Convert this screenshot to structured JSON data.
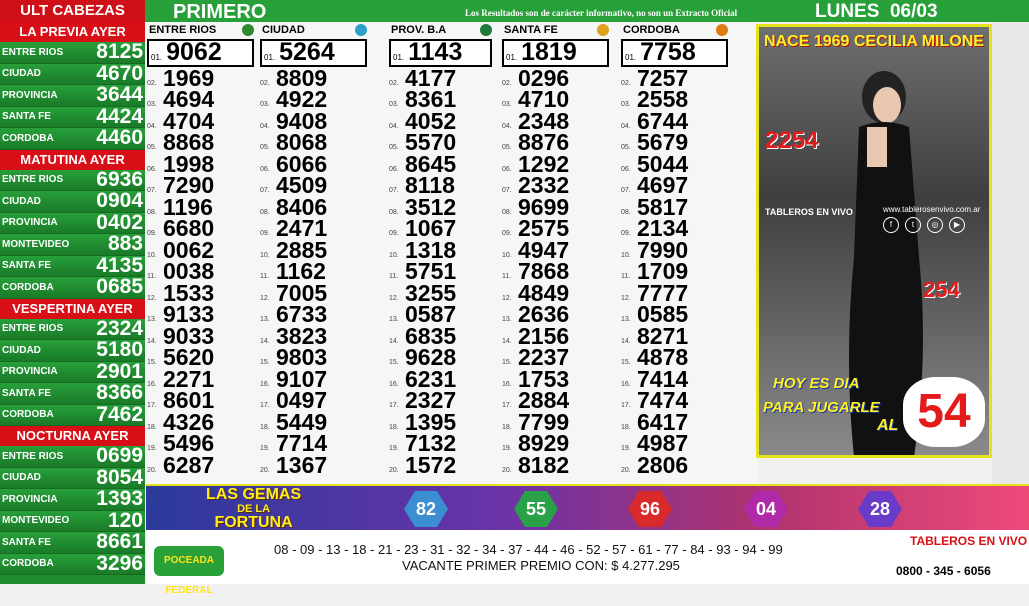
{
  "sidebar": {
    "title": "ULT CABEZAS",
    "sections": [
      {
        "heading": "LA PREVIA AYER",
        "rows": [
          {
            "name": "ENTRE RIOS",
            "value": "8125"
          },
          {
            "name": "CIUDAD",
            "value": "4670"
          },
          {
            "name": "PROVINCIA",
            "value": "3644"
          },
          {
            "name": "SANTA FE",
            "value": "4424"
          },
          {
            "name": "CORDOBA",
            "value": "4460"
          }
        ]
      },
      {
        "heading": "MATUTINA AYER",
        "rows": [
          {
            "name": "ENTRE RIOS",
            "value": "6936"
          },
          {
            "name": "CIUDAD",
            "value": "0904"
          },
          {
            "name": "PROVINCIA",
            "value": "0402"
          },
          {
            "name": "MONTEVIDEO",
            "value": "883"
          },
          {
            "name": "SANTA FE",
            "value": "4135"
          },
          {
            "name": "CORDOBA",
            "value": "0685"
          }
        ]
      },
      {
        "heading": "VESPERTINA AYER",
        "rows": [
          {
            "name": "ENTRE RIOS",
            "value": "2324"
          },
          {
            "name": "CIUDAD",
            "value": "5180"
          },
          {
            "name": "PROVINCIA",
            "value": "2901"
          },
          {
            "name": "SANTA FE",
            "value": "8366"
          },
          {
            "name": "CORDOBA",
            "value": "7462"
          }
        ]
      },
      {
        "heading": "NOCTURNA AYER",
        "rows": [
          {
            "name": "ENTRE RIOS",
            "value": "0699"
          },
          {
            "name": "CIUDAD",
            "value": "8054"
          },
          {
            "name": "PROVINCIA",
            "value": "1393"
          },
          {
            "name": "MONTEVIDEO",
            "value": "120"
          },
          {
            "name": "SANTA FE",
            "value": "8661"
          },
          {
            "name": "CORDOBA",
            "value": "3296"
          }
        ]
      }
    ]
  },
  "header": {
    "draw": "PRIMERO",
    "note": "Los Resultados son de carácter informativo, no son un Extracto Oficial",
    "day": "LUNES",
    "date": "06/03"
  },
  "columns": [
    {
      "name": "ENTRE RIOS",
      "icon": "entre-rios-icon",
      "color": "#2f8a2f",
      "numbers": [
        "9062",
        "1969",
        "4694",
        "4704",
        "8868",
        "1998",
        "7290",
        "1196",
        "6680",
        "0062",
        "0038",
        "1533",
        "9133",
        "9033",
        "5620",
        "2271",
        "8601",
        "4326",
        "5496",
        "6287"
      ]
    },
    {
      "name": "CIUDAD",
      "icon": "ciudad-icon",
      "color": "#2aa0c8",
      "numbers": [
        "5264",
        "8809",
        "4922",
        "9408",
        "8068",
        "6066",
        "4509",
        "8406",
        "2471",
        "2885",
        "1162",
        "7005",
        "6733",
        "3823",
        "9803",
        "9107",
        "0497",
        "5449",
        "7714",
        "1367"
      ]
    },
    {
      "name": "PROV. B.A",
      "icon": "provincia-icon",
      "color": "#1f7a3a",
      "numbers": [
        "1143",
        "4177",
        "8361",
        "4052",
        "5570",
        "8645",
        "8118",
        "3512",
        "1067",
        "1318",
        "5751",
        "3255",
        "0587",
        "6835",
        "9628",
        "6231",
        "2327",
        "1395",
        "7132",
        "1572"
      ]
    },
    {
      "name": "SANTA FE",
      "icon": "santa-fe-icon",
      "color": "#e0a020",
      "numbers": [
        "1819",
        "0296",
        "4710",
        "2348",
        "8876",
        "1292",
        "2332",
        "9699",
        "2575",
        "4947",
        "7868",
        "4849",
        "2636",
        "2156",
        "2237",
        "1753",
        "2884",
        "7799",
        "8929",
        "8182"
      ]
    },
    {
      "name": "CORDOBA",
      "icon": "cordoba-icon",
      "color": "#e07a10",
      "numbers": [
        "7758",
        "7257",
        "2558",
        "6744",
        "5679",
        "5044",
        "4697",
        "5817",
        "2134",
        "7990",
        "1709",
        "7777",
        "0585",
        "8271",
        "4878",
        "7414",
        "7474",
        "6417",
        "4987",
        "2806"
      ]
    }
  ],
  "positions": [
    "01.",
    "02.",
    "03.",
    "04.",
    "05.",
    "06.",
    "07.",
    "08.",
    "09.",
    "10.",
    "11.",
    "12.",
    "13.",
    "14.",
    "15.",
    "16.",
    "17.",
    "18.",
    "19.",
    "20."
  ],
  "ad": {
    "headline": "NACE 1969 CECILIA MILONE",
    "number_a": "2254",
    "number_b": "254",
    "logo": "TABLEROS EN VIVO",
    "website": "www.tablerosenvivo.com.ar",
    "line1": "HOY ES DIA",
    "line2": "PARA JUGARLE",
    "line3": "AL",
    "lucky": "54"
  },
  "gemas": {
    "title_line1": "LAS GEMAS",
    "title_line2": "DE LA",
    "title_line3": "FORTUNA",
    "values": [
      {
        "value": "82",
        "color": "#3b8fd0"
      },
      {
        "value": "55",
        "color": "#2aa048"
      },
      {
        "value": "96",
        "color": "#d82a2a"
      },
      {
        "value": "04",
        "color": "#b02aa8"
      },
      {
        "value": "28",
        "color": "#6a3ac8"
      }
    ]
  },
  "footer": {
    "brand": "POCEADA FEDERAL",
    "numbers": "08 - 09 - 13 - 18 - 21 - 23 - 31 - 32 - 34 - 37 - 44 - 46 - 52 - 57 - 61 - 77 - 84 - 93 - 94 - 99",
    "vacante": "VACANTE PRIMER PREMIO CON: $ 4.277.295",
    "logo": "TABLEROS EN VIVO",
    "phone": "0800 - 345 - 6056"
  }
}
